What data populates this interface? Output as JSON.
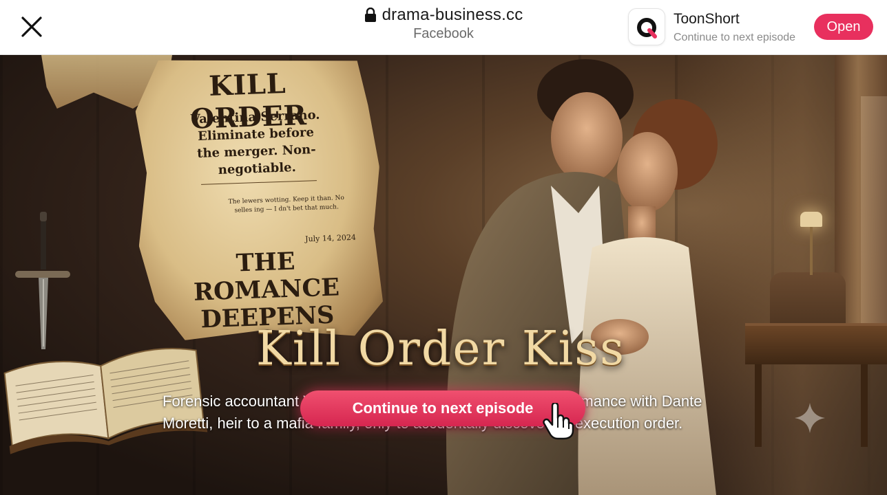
{
  "browser": {
    "domain": "drama-business.cc",
    "source": "Facebook"
  },
  "app": {
    "name": "ToonShort",
    "subtitle": "Continue to next episode",
    "open_label": "Open",
    "accent_color": "#e8305e",
    "logo_icon": "q-logo-icon"
  },
  "ad": {
    "parchment": {
      "title": "KILL ORDER",
      "body": "Valentina Serrano. Eliminate before the merger. Non-negotiable.",
      "small_print": "The lewers wotting. Keep it than. No selles ing — I dn't bet that much.",
      "date": "July 14, 2024",
      "headline": "THE ROMANCE DEEPENS"
    },
    "show_title": "Kill Order Kiss",
    "description": "Forensic accountant Valentina Serrano falls into a forbidden romance with Dante Moretti, heir to a mafia family, only to accdentally discover an execution order.",
    "cta_label": "Continue to next episode"
  }
}
